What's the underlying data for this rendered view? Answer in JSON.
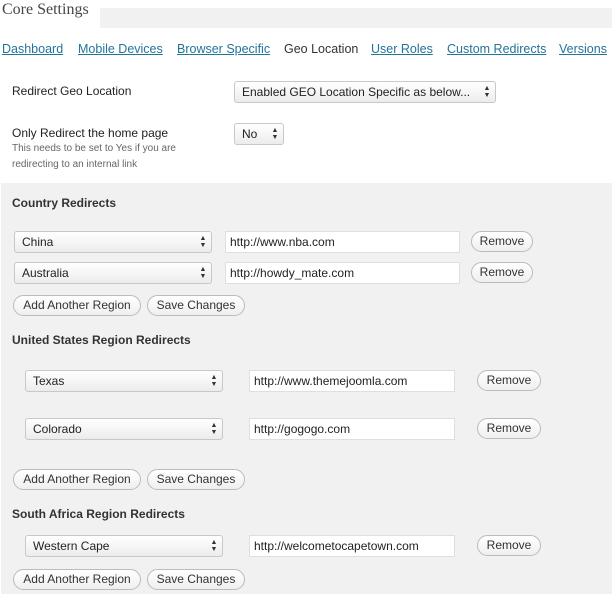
{
  "page": {
    "title": "Core Settings"
  },
  "tabs": [
    {
      "label": "Dashboard"
    },
    {
      "label": "Mobile Devices"
    },
    {
      "label": "Browser Specific"
    },
    {
      "label": "Geo Location"
    },
    {
      "label": "User Roles"
    },
    {
      "label": "Custom Redirects"
    },
    {
      "label": "Versions"
    }
  ],
  "active_tab": "Geo Location",
  "settings": {
    "redirect_geo": {
      "label": "Redirect Geo Location",
      "value": "Enabled GEO Location Specific as below..."
    },
    "home_only": {
      "label": "Only Redirect the home page",
      "hint": "This needs to be set to Yes if you are redirecting to an internal link",
      "value": "No"
    }
  },
  "country": {
    "title": "Country Redirects",
    "rows": [
      {
        "region": "China",
        "url": "http://www.nba.com",
        "remove": "Remove"
      },
      {
        "region": "Australia",
        "url": "http://howdy_mate.com",
        "remove": "Remove"
      }
    ],
    "add_label": "Add Another Region",
    "save_label": "Save Changes"
  },
  "us": {
    "title": "United States Region Redirects",
    "rows": [
      {
        "region": "Texas",
        "url": "http://www.themejoomla.com",
        "remove": "Remove"
      },
      {
        "region": "Colorado",
        "url": "http://gogogo.com",
        "remove": "Remove"
      }
    ],
    "add_label": "Add Another Region",
    "save_label": "Save Changes"
  },
  "za": {
    "title": "South Africa Region Redirects",
    "rows": [
      {
        "region": "Western Cape",
        "url": "http://welcometocapetown.com",
        "remove": "Remove"
      }
    ],
    "add_label": "Add Another Region",
    "save_label": "Save Changes"
  },
  "icons": {
    "select_arrows": "updown-arrows-icon"
  }
}
